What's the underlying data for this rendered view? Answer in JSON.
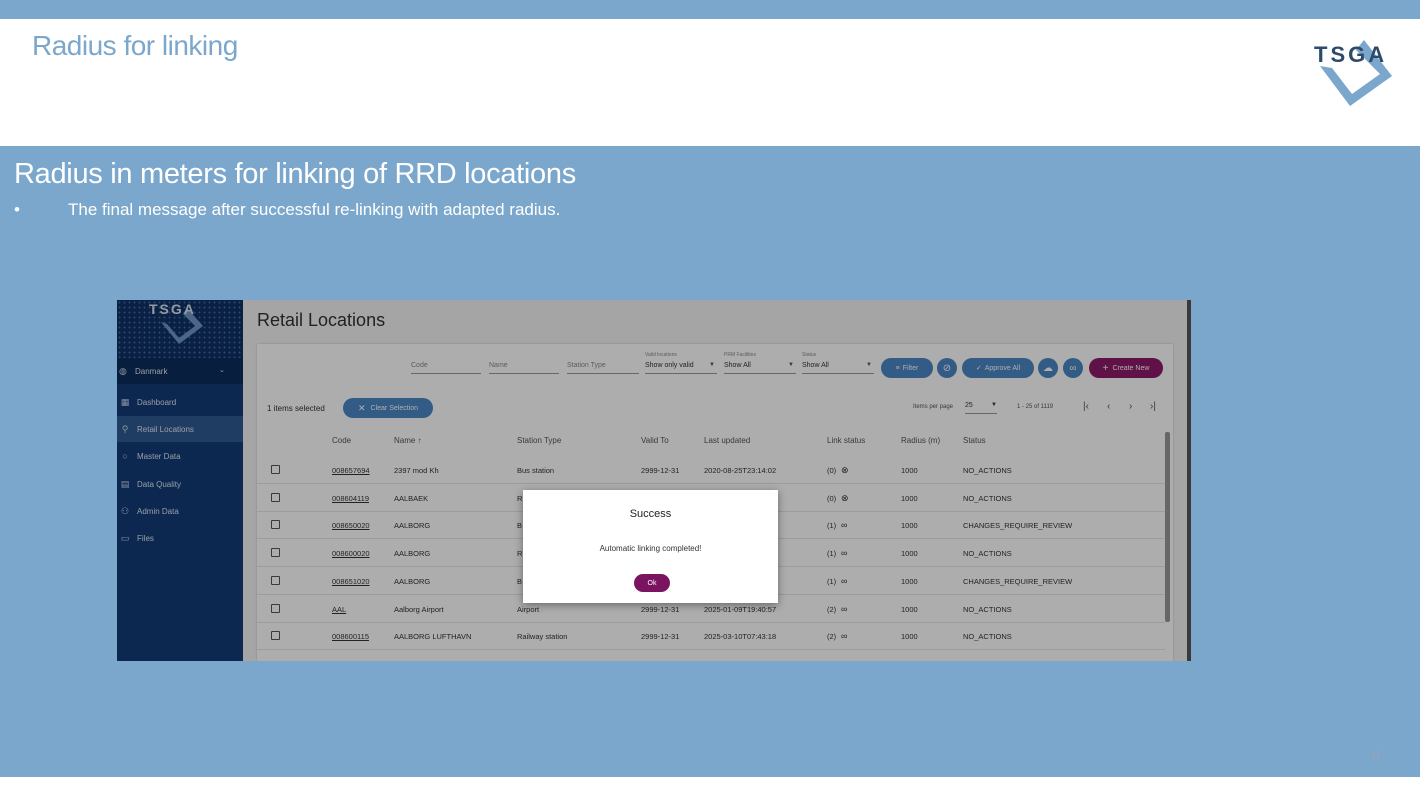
{
  "slide": {
    "title": "Radius for linking",
    "subtitle": "Radius in meters for linking of RRD locations",
    "bullet_symbol": "•",
    "bullet": "The final message after successful re-linking with adapted radius.",
    "page_number": "6",
    "logo_text": "TSGA"
  },
  "app": {
    "sidebar": {
      "logo_text": "TSGA",
      "country": "Danmark",
      "items": [
        {
          "label": "Dashboard",
          "icon": "dashboard-icon"
        },
        {
          "label": "Retail Locations",
          "icon": "location-pin-icon"
        },
        {
          "label": "Master Data",
          "icon": "circle-icon"
        },
        {
          "label": "Data Quality",
          "icon": "grid-icon"
        },
        {
          "label": "Admin Data",
          "icon": "people-icon"
        },
        {
          "label": "Files",
          "icon": "folder-icon"
        }
      ]
    },
    "page_title": "Retail Locations",
    "filters": {
      "code_label": "Code",
      "name_label": "Name",
      "station_type_label": "Station Type",
      "valid_label": "Valid locations",
      "valid_value": "Show only valid",
      "prm_label": "PRM Facilities",
      "prm_value": "Show All",
      "status_label": "Status",
      "status_value": "Show All",
      "filter_button": "Filter",
      "approve_all_button": "Approve All",
      "create_new_button": "Create New"
    },
    "selection": {
      "text": "1 items selected",
      "clear_button": "Clear Selection",
      "items_per_page_label": "Items per page",
      "items_per_page_value": "25",
      "range": "1 - 25 of 1119"
    },
    "table": {
      "headers": [
        "Code",
        "Name ↑",
        "Station Type",
        "Valid To",
        "Last updated",
        "Link status",
        "Radius (m)",
        "Status"
      ],
      "rows": [
        {
          "code": "008657694",
          "name": "2397 mod Kh",
          "type": "Bus station",
          "valid": "2999-12-31",
          "updated": "2020-08-25T23:14:02",
          "link": "(0)",
          "radius": "1000",
          "status": "NO_ACTIONS"
        },
        {
          "code": "008604119",
          "name": "AALBAEK",
          "type": "R",
          "valid": "",
          "updated": "",
          "link": "(0)",
          "radius": "1000",
          "status": "NO_ACTIONS"
        },
        {
          "code": "008650020",
          "name": "AALBORG",
          "type": "B",
          "valid": "",
          "updated": "",
          "link": "(1)",
          "radius": "1000",
          "status": "CHANGES_REQUIRE_REVIEW"
        },
        {
          "code": "008600020",
          "name": "AALBORG",
          "type": "R",
          "valid": "",
          "updated": "",
          "link": "(1)",
          "radius": "1000",
          "status": "NO_ACTIONS"
        },
        {
          "code": "008651020",
          "name": "AALBORG",
          "type": "B",
          "valid": "",
          "updated": "",
          "link": "(1)",
          "radius": "1000",
          "status": "CHANGES_REQUIRE_REVIEW"
        },
        {
          "code": "AAL",
          "name": "Aalborg Airport",
          "type": "Airport",
          "valid": "2999-12-31",
          "updated": "2025-01-09T19:40:57",
          "link": "(2)",
          "radius": "1000",
          "status": "NO_ACTIONS"
        },
        {
          "code": "008600115",
          "name": "AALBORG LUFTHAVN",
          "type": "Railway station",
          "valid": "2999-12-31",
          "updated": "2025-03-10T07:43:18",
          "link": "(2)",
          "radius": "1000",
          "status": "NO_ACTIONS"
        }
      ]
    },
    "dialog": {
      "title": "Success",
      "message": "Automatic linking completed!",
      "ok_button": "Ok"
    }
  },
  "colors": {
    "slide_blue": "#7ba7cc",
    "sidebar_navy": "#123c78",
    "accent_blue": "#4a88c4",
    "create_purple": "#8c1a6a",
    "ok_purple": "#7a1461"
  }
}
